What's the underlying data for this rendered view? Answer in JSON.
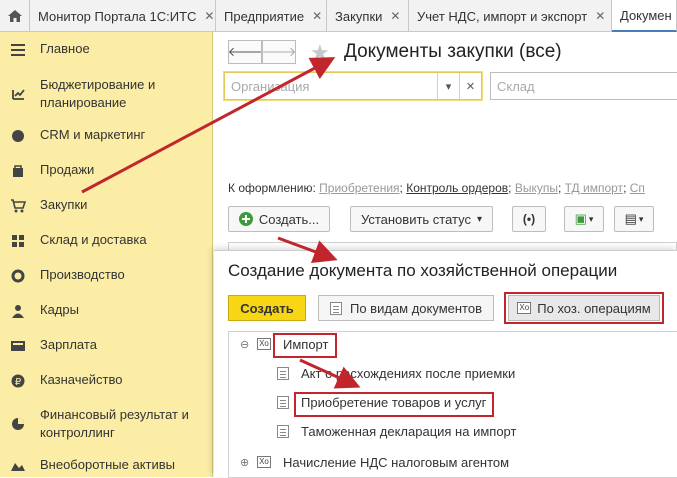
{
  "tabs": [
    {
      "label": "Монитор Портала 1С:ИТС"
    },
    {
      "label": "Предприятие"
    },
    {
      "label": "Закупки"
    },
    {
      "label": "Учет НДС, импорт и экспорт"
    },
    {
      "label": "Докумен"
    }
  ],
  "sidebar": {
    "items": [
      {
        "label": "Главное",
        "icon": "menu-icon"
      },
      {
        "label": "Бюджетирование и планирование",
        "icon": "budget-icon"
      },
      {
        "label": "CRM и маркетинг",
        "icon": "crm-icon"
      },
      {
        "label": "Продажи",
        "icon": "sales-icon"
      },
      {
        "label": "Закупки",
        "icon": "cart-icon"
      },
      {
        "label": "Склад и доставка",
        "icon": "warehouse-icon"
      },
      {
        "label": "Производство",
        "icon": "factory-icon"
      },
      {
        "label": "Кадры",
        "icon": "person-icon"
      },
      {
        "label": "Зарплата",
        "icon": "salary-icon"
      },
      {
        "label": "Казначейство",
        "icon": "ruble-icon"
      },
      {
        "label": "Финансовый результат и контроллинг",
        "icon": "finance-icon"
      },
      {
        "label": "Внеоборотные активы",
        "icon": "assets-icon"
      }
    ]
  },
  "page": {
    "title": "Документы закупки (все)",
    "org_placeholder": "Организация",
    "warehouse_placeholder": "Склад",
    "oform_label": "К оформлению:",
    "oform_links": [
      "Приобретения",
      "Контроль ордеров",
      "Выкупы",
      "ТД импорт",
      "Сп"
    ],
    "create_label": "Создать...",
    "set_status_label": "Установить статус"
  },
  "popup": {
    "title": "Создание документа по хозяйственной операции",
    "create_label": "Создать",
    "by_doc_types_label": "По видам документов",
    "by_operations_label": "По хоз. операциям",
    "tree": [
      {
        "label": "Импорт",
        "level": 0,
        "expanded": true
      },
      {
        "label": "Акт о расхождениях после приемки",
        "level": 1
      },
      {
        "label": "Приобретение товаров и услуг",
        "level": 1
      },
      {
        "label": "Таможенная декларация на импорт",
        "level": 1
      },
      {
        "label": "Начисление НДС налоговым агентом",
        "level": 0,
        "expanded": false
      }
    ]
  },
  "colors": {
    "sidebar_bg": "#fbeda6",
    "accent_yellow": "#f6d615",
    "highlight_red": "#c0262c"
  }
}
